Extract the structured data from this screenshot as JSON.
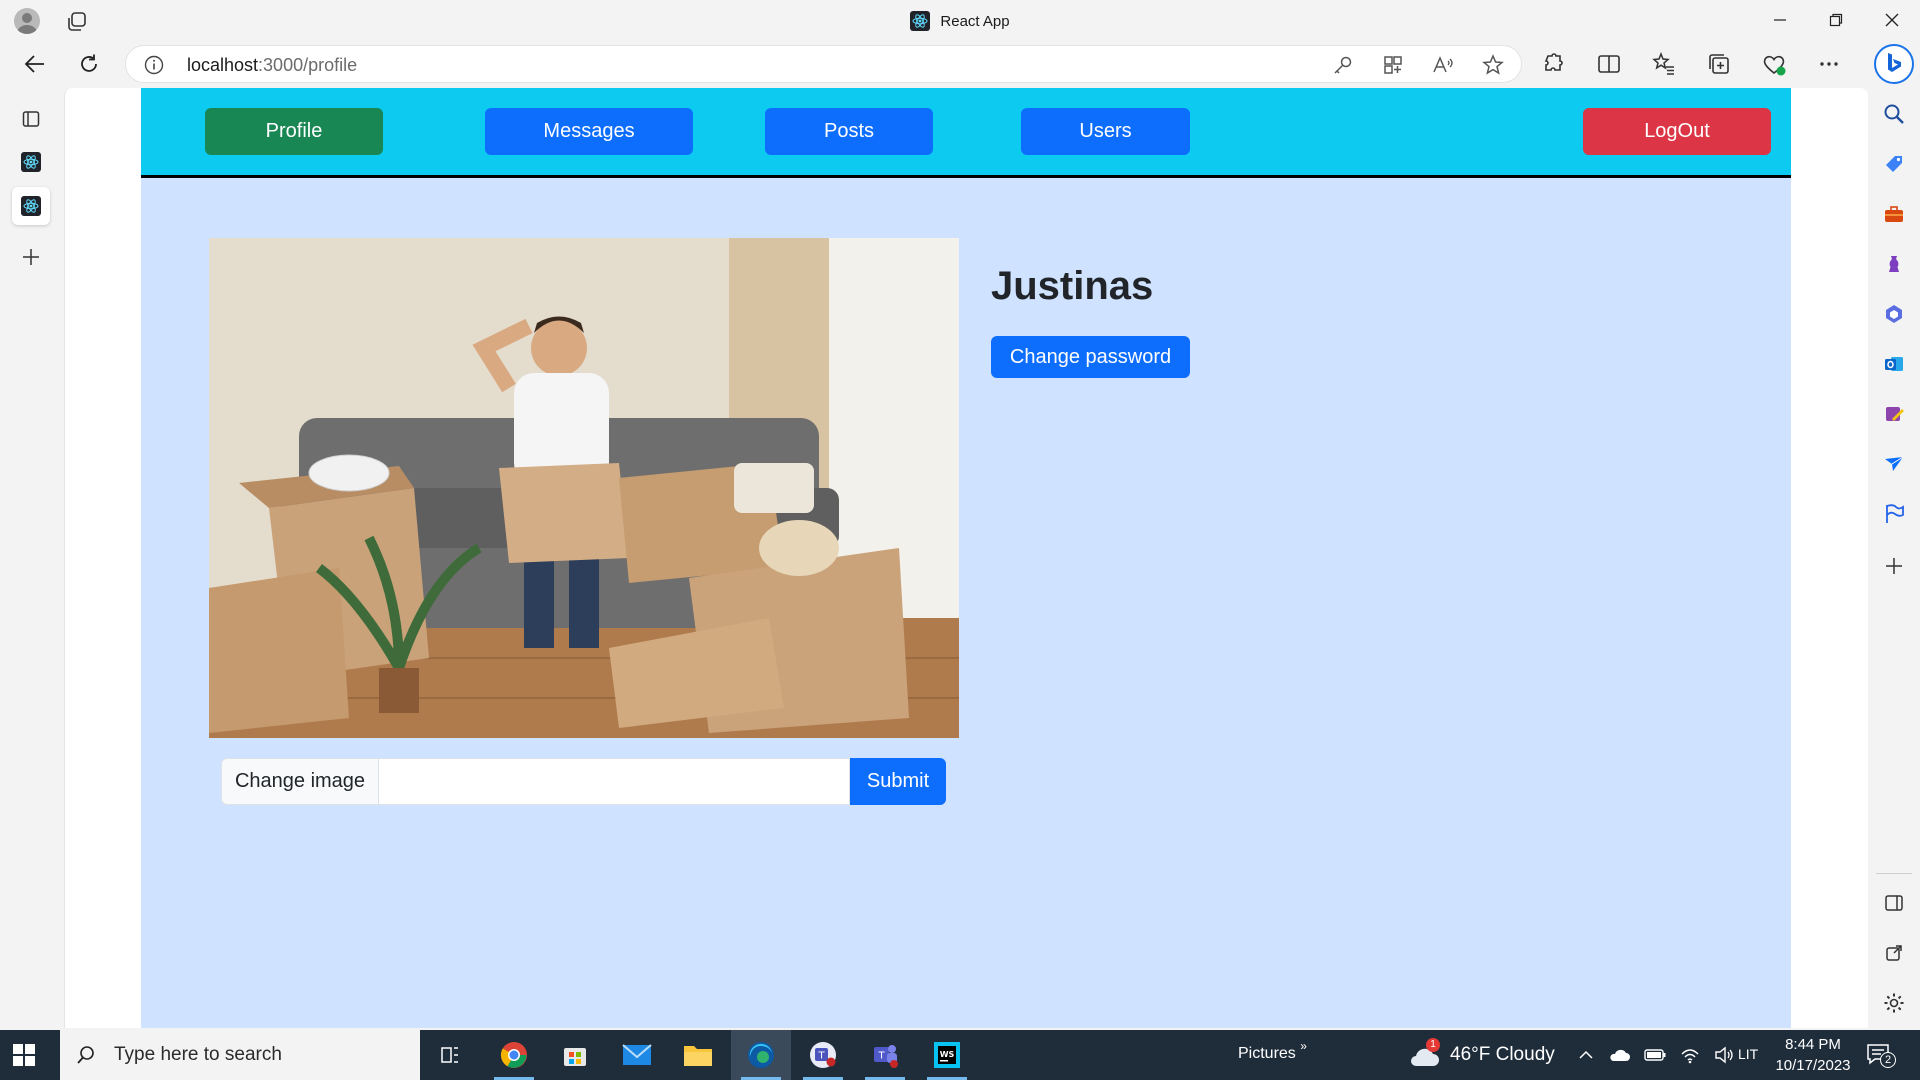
{
  "browser": {
    "tab_title": "React App",
    "url_host": "localhost",
    "url_path": ":3000/profile"
  },
  "app": {
    "nav": {
      "profile": "Profile",
      "messages": "Messages",
      "posts": "Posts",
      "users": "Users",
      "logout": "LogOut"
    },
    "profile": {
      "username": "Justinas",
      "change_password": "Change password",
      "image_label": "Change image",
      "image_value": "",
      "submit": "Submit"
    },
    "colors": {
      "nav_bg": "#0dcaf0",
      "page_bg": "#cfe2ff",
      "primary": "#0d6efd",
      "success": "#198754",
      "danger": "#dc3545"
    }
  },
  "taskbar": {
    "search_placeholder": "Type here to search",
    "pictures": "Pictures",
    "weather": "46°F  Cloudy",
    "weather_badge": "1",
    "language": "LIT",
    "time": "8:44 PM",
    "date": "10/17/2023",
    "notifications": "2"
  }
}
